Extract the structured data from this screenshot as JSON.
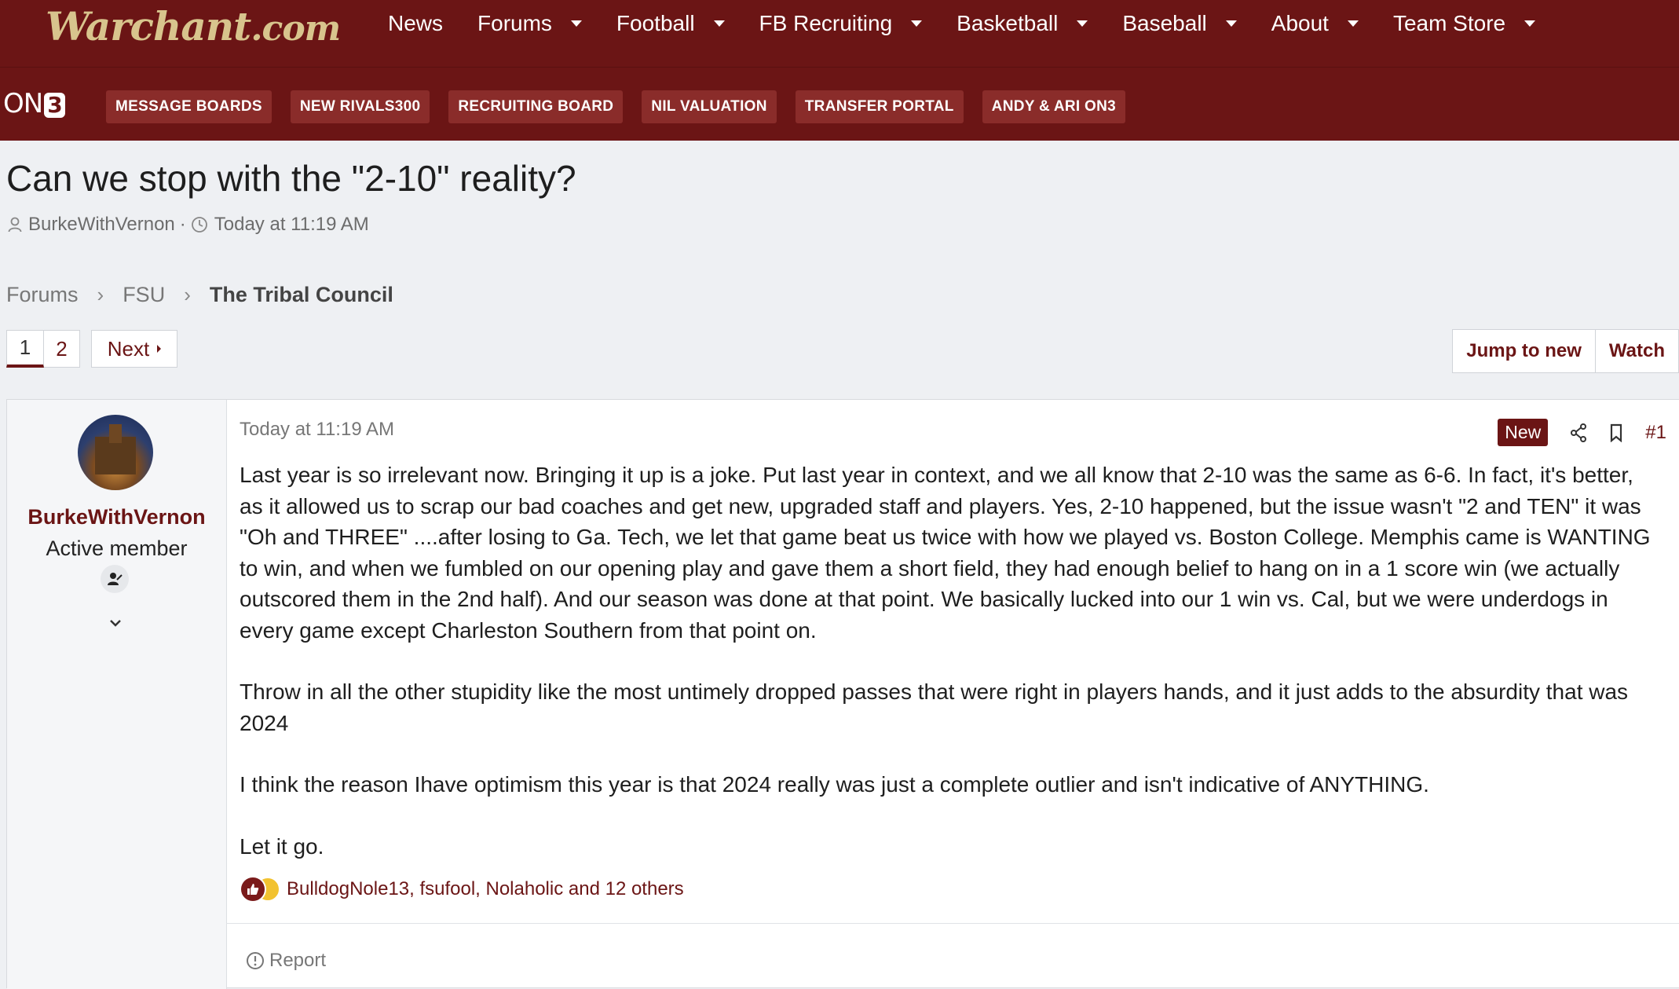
{
  "site": {
    "logo_main": "Warchant",
    "logo_suffix": ".com",
    "nav": [
      "News",
      "Forums",
      "Football",
      "FB Recruiting",
      "Basketball",
      "Baseball",
      "About",
      "Team Store"
    ],
    "on3_text": "ON",
    "on3_num": "3",
    "subnav": [
      "MESSAGE BOARDS",
      "NEW RIVALS300",
      "RECRUITING BOARD",
      "NIL VALUATION",
      "TRANSFER PORTAL",
      "ANDY & ARI ON3"
    ]
  },
  "thread": {
    "title": "Can we stop with the \"2-10\" reality?",
    "author": "BurkeWithVernon",
    "meta_sep": "·",
    "time": "Today at 11:19 AM"
  },
  "breadcrumb": [
    "Forums",
    "FSU",
    "The Tribal Council"
  ],
  "pagination": {
    "pages": [
      "1",
      "2"
    ],
    "next_label": "Next"
  },
  "actions": {
    "jump_label": "Jump to new",
    "watch_label": "Watch"
  },
  "post": {
    "user": {
      "name": "BurkeWithVernon",
      "title": "Active member"
    },
    "time": "Today at 11:19 AM",
    "new_label": "New",
    "number": "#1",
    "paragraphs": [
      "Last year is so irrelevant now. Bringing it up is a joke. Put last year in context, and we all know that 2-10 was the same as 6-6. In fact, it's better, as it allowed us to scrap our bad coaches and get new, upgraded staff and players. Yes, 2-10 happened, but the issue wasn't \"2 and TEN\" it was \"Oh and THREE\" ....after losing to Ga. Tech, we let that game beat us twice with how we played vs. Boston College. Memphis came is WANTING to win, and when we fumbled on our opening play and gave them a short field, they had enough belief to hang on in a 1 score win (we actually outscored them in the 2nd half). And our season was done at that point. We basically lucked into our 1 win vs. Cal, but we were underdogs in every game except Charleston Southern from that point on.",
      "Throw in all the other stupidity like the most untimely dropped passes that were right in players hands, and it just adds to the absurdity that was 2024",
      "I think the reason Ihave optimism this year is that 2024 really was just a complete outlier and isn't indicative of ANYTHING.",
      "Let it go."
    ],
    "reactions_text": "BulldogNole13, fsufool, Nolaholic and 12 others",
    "report_label": "Report"
  },
  "colors": {
    "brand": "#6b1515",
    "gold": "#d8c48d",
    "pill": "#8a2c2a"
  }
}
